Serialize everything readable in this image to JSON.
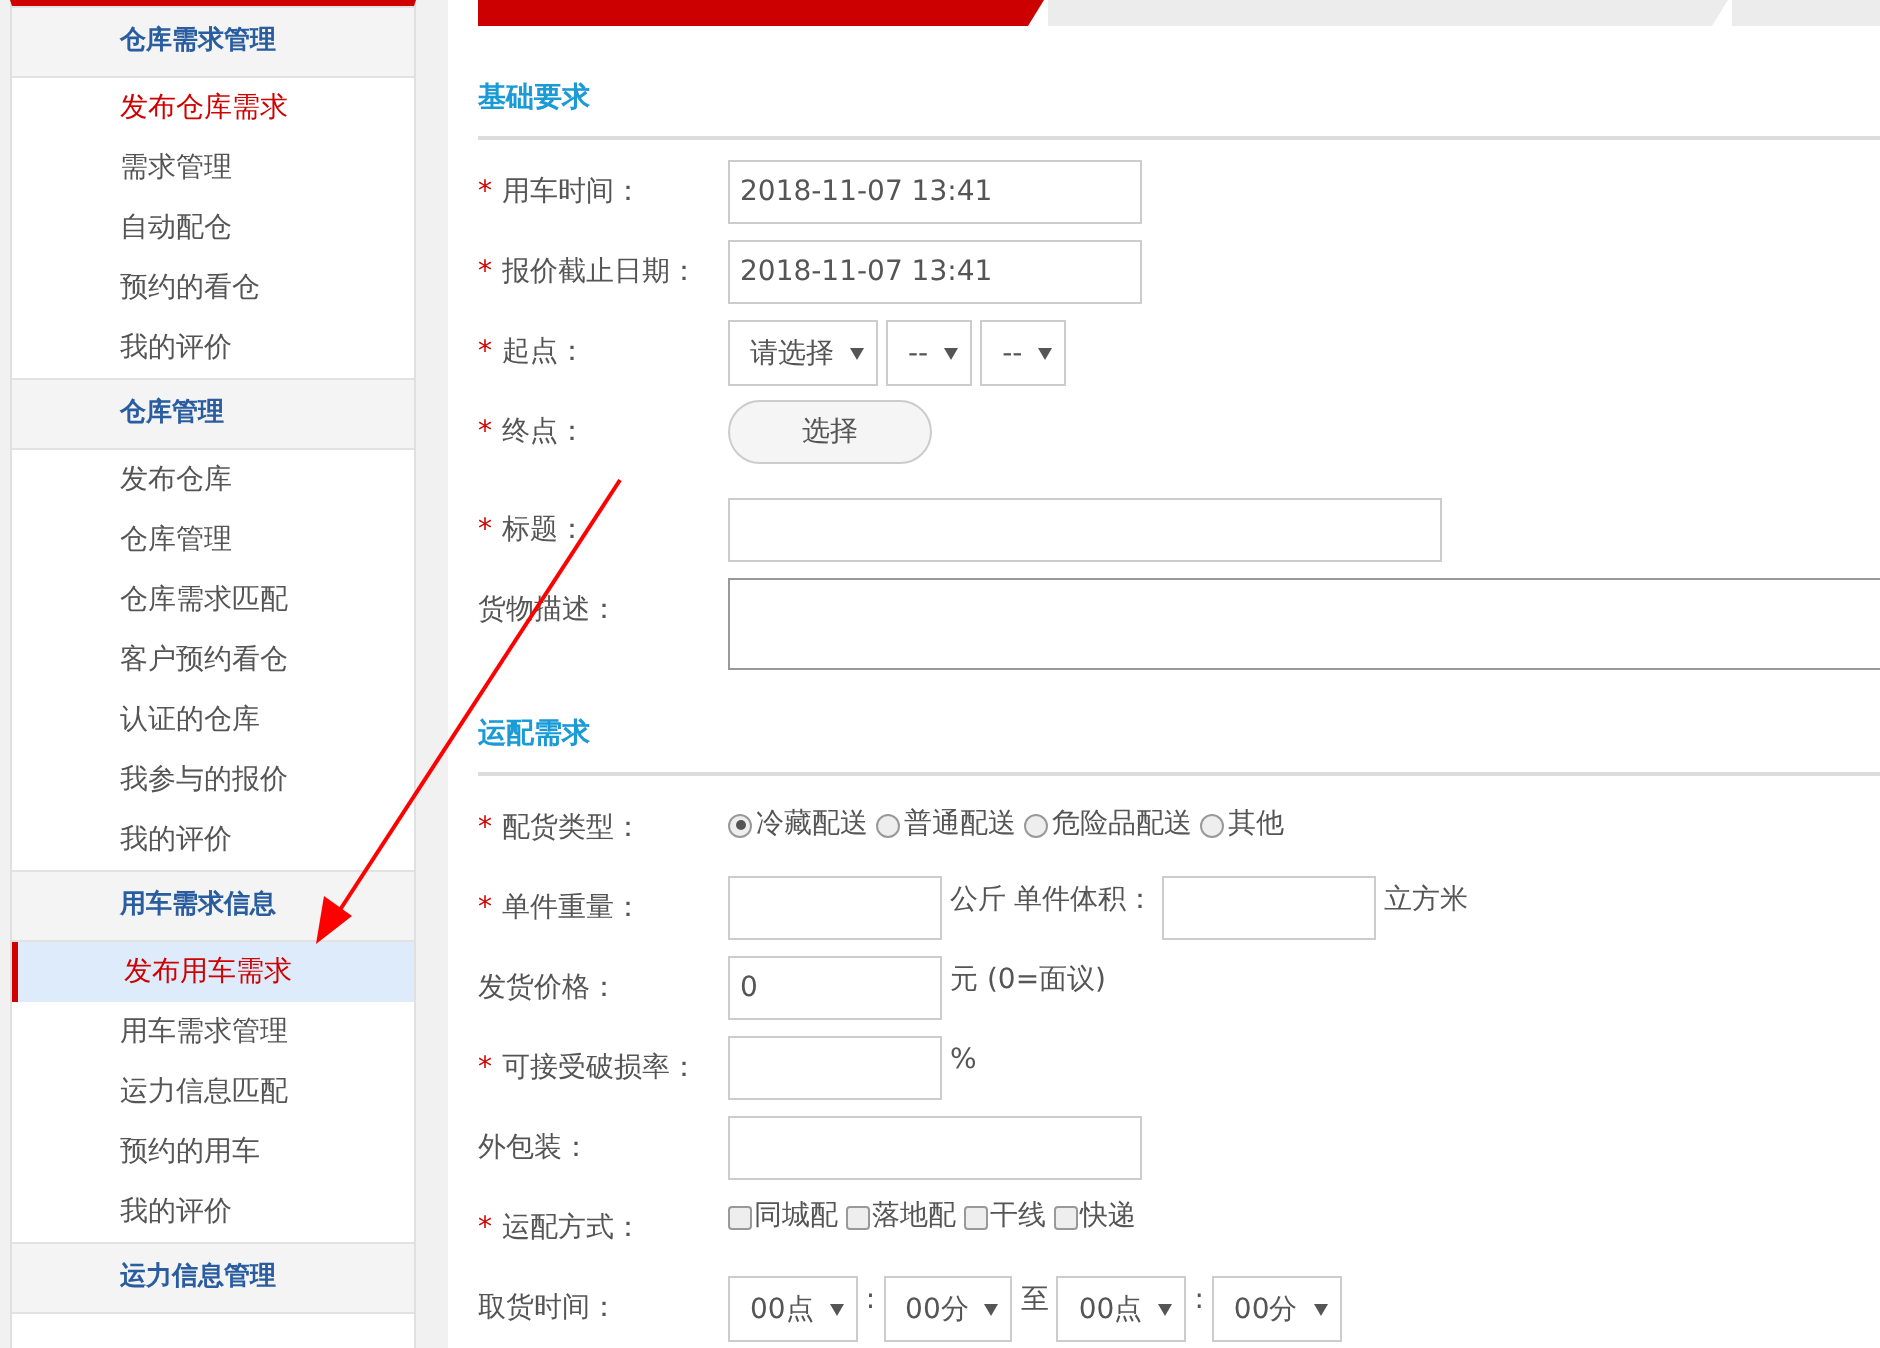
{
  "sidebar": {
    "groups": [
      {
        "title": "仓库需求管理",
        "items": [
          {
            "label": "发布仓库需求",
            "selected": false,
            "highlighted": true
          },
          {
            "label": "需求管理",
            "selected": false,
            "highlighted": false
          },
          {
            "label": "自动配仓",
            "selected": false,
            "highlighted": false
          },
          {
            "label": "预约的看仓",
            "selected": false,
            "highlighted": false
          },
          {
            "label": "我的评价",
            "selected": false,
            "highlighted": false
          }
        ]
      },
      {
        "title": "仓库管理",
        "items": [
          {
            "label": "发布仓库",
            "selected": false,
            "highlighted": false
          },
          {
            "label": "仓库管理",
            "selected": false,
            "highlighted": false
          },
          {
            "label": "仓库需求匹配",
            "selected": false,
            "highlighted": false
          },
          {
            "label": "客户预约看仓",
            "selected": false,
            "highlighted": false
          },
          {
            "label": "认证的仓库",
            "selected": false,
            "highlighted": false
          },
          {
            "label": "我参与的报价",
            "selected": false,
            "highlighted": false
          },
          {
            "label": "我的评价",
            "selected": false,
            "highlighted": false
          }
        ]
      },
      {
        "title": "用车需求信息",
        "items": [
          {
            "label": "发布用车需求",
            "selected": true
          },
          {
            "label": "用车需求管理",
            "selected": false,
            "highlighted": false
          },
          {
            "label": "运力信息匹配",
            "selected": false,
            "highlighted": false
          },
          {
            "label": "预约的用车",
            "selected": false,
            "highlighted": false
          },
          {
            "label": "我的评价",
            "selected": false,
            "highlighted": false
          }
        ]
      },
      {
        "title": "运力信息管理"
      }
    ]
  },
  "steps": [
    {
      "selected": true
    },
    {
      "selected": false
    },
    {
      "selected": false
    }
  ],
  "sections": [
    {
      "title": "基础要求",
      "rows": [
        {
          "asterisk": "*",
          "label": "用车时间：",
          "controls": [
            {
              "kind": "input",
              "value": "2018-11-07 13:41"
            }
          ]
        },
        {
          "asterisk": "*",
          "label": "报价截止日期：",
          "controls": [
            {
              "kind": "input",
              "value": "2018-11-07 13:41"
            }
          ]
        },
        {
          "asterisk": "*",
          "label": "起点：",
          "controls": [
            {
              "kind": "select",
              "value": "请选择"
            },
            {
              "kind": "select",
              "value": "--"
            },
            {
              "kind": "select",
              "value": "--"
            }
          ]
        },
        {
          "asterisk": "*",
          "label": "终点：",
          "controls": [
            {
              "kind": "button",
              "label": "选择"
            }
          ]
        },
        {
          "asterisk": "*",
          "label": "标题：",
          "controls": [
            {
              "kind": "wide-input"
            }
          ]
        },
        {
          "label": "货物描述：",
          "controls": [
            {
              "kind": "textarea"
            }
          ]
        }
      ]
    },
    {
      "title": "运配需求",
      "rows": [
        {
          "asterisk": "*",
          "label": "配货类型：",
          "controls": [
            {
              "kind": "radio",
              "label": "冷藏配送",
              "selected": true
            },
            {
              "kind": "radio",
              "label": "普通配送",
              "selected": false
            },
            {
              "kind": "radio",
              "label": "危险品配送",
              "selected": false
            },
            {
              "kind": "radio",
              "label": "其他",
              "selected": false
            }
          ]
        },
        {
          "asterisk": "*",
          "label": "单件重量：",
          "controls": [
            {
              "kind": "short-input"
            },
            {
              "kind": "text",
              "text": "公斤"
            },
            {
              "kind": "text",
              "text": "单件体积："
            },
            {
              "kind": "short-input"
            },
            {
              "kind": "text",
              "text": "立方米"
            }
          ]
        },
        {
          "label": "发货价格：",
          "controls": [
            {
              "kind": "short-input",
              "value": "0"
            },
            {
              "kind": "text",
              "text": "元 (0=面议)"
            }
          ]
        },
        {
          "asterisk": "*",
          "label": "可接受破损率：",
          "controls": [
            {
              "kind": "short-input"
            },
            {
              "kind": "text",
              "text": "%"
            }
          ]
        },
        {
          "label": "外包装：",
          "controls": [
            {
              "kind": "input"
            }
          ]
        },
        {
          "asterisk": "*",
          "label": "运配方式：",
          "controls": [
            {
              "kind": "checkbox",
              "label": "同城配",
              "checked": false
            },
            {
              "kind": "checkbox",
              "label": "落地配",
              "checked": false
            },
            {
              "kind": "checkbox",
              "label": "干线",
              "checked": false
            },
            {
              "kind": "checkbox",
              "label": "快递",
              "checked": false
            }
          ]
        },
        {
          "label": "取货时间：",
          "controls": [
            {
              "kind": "select",
              "value": "00点"
            },
            {
              "kind": "text",
              "text": ":"
            },
            {
              "kind": "select",
              "value": "00分"
            },
            {
              "kind": "text",
              "text": "至"
            },
            {
              "kind": "select",
              "value": "00点"
            },
            {
              "kind": "text",
              "text": ":"
            },
            {
              "kind": "select",
              "value": "00分"
            }
          ]
        }
      ]
    }
  ]
}
